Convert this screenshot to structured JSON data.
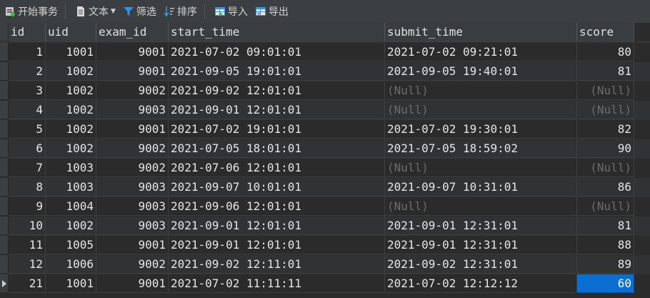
{
  "toolbar": {
    "begin_transaction": "开始事务",
    "text": "文本",
    "filter": "筛选",
    "sort": "排序",
    "import": "导入",
    "export": "导出"
  },
  "columns": [
    "id",
    "uid",
    "exam_id",
    "start_time",
    "submit_time",
    "score"
  ],
  "rows": [
    {
      "id": "1",
      "uid": "1001",
      "exam_id": "9001",
      "start_time": "2021-07-02 09:01:01",
      "submit_time": "2021-07-02 09:21:01",
      "score": "80"
    },
    {
      "id": "2",
      "uid": "1002",
      "exam_id": "9001",
      "start_time": "2021-09-05 19:01:01",
      "submit_time": "2021-09-05 19:40:01",
      "score": "81"
    },
    {
      "id": "3",
      "uid": "1002",
      "exam_id": "9002",
      "start_time": "2021-09-02 12:01:01",
      "submit_time": "(Null)",
      "score": "(Null)"
    },
    {
      "id": "4",
      "uid": "1002",
      "exam_id": "9003",
      "start_time": "2021-09-01 12:01:01",
      "submit_time": "(Null)",
      "score": "(Null)"
    },
    {
      "id": "5",
      "uid": "1002",
      "exam_id": "9001",
      "start_time": "2021-07-02 19:01:01",
      "submit_time": "2021-07-02 19:30:01",
      "score": "82"
    },
    {
      "id": "6",
      "uid": "1002",
      "exam_id": "9002",
      "start_time": "2021-07-05 18:01:01",
      "submit_time": "2021-07-05 18:59:02",
      "score": "90"
    },
    {
      "id": "7",
      "uid": "1003",
      "exam_id": "9002",
      "start_time": "2021-07-06 12:01:01",
      "submit_time": "(Null)",
      "score": "(Null)"
    },
    {
      "id": "8",
      "uid": "1003",
      "exam_id": "9003",
      "start_time": "2021-09-07 10:01:01",
      "submit_time": "2021-09-07 10:31:01",
      "score": "86"
    },
    {
      "id": "9",
      "uid": "1004",
      "exam_id": "9003",
      "start_time": "2021-09-06 12:01:01",
      "submit_time": "(Null)",
      "score": "(Null)"
    },
    {
      "id": "10",
      "uid": "1002",
      "exam_id": "9003",
      "start_time": "2021-09-01 12:01:01",
      "submit_time": "2021-09-01 12:31:01",
      "score": "81"
    },
    {
      "id": "11",
      "uid": "1005",
      "exam_id": "9001",
      "start_time": "2021-09-01 12:01:01",
      "submit_time": "2021-09-01 12:31:01",
      "score": "88"
    },
    {
      "id": "12",
      "uid": "1006",
      "exam_id": "9002",
      "start_time": "2021-09-02 12:11:01",
      "submit_time": "2021-09-02 12:31:01",
      "score": "89"
    },
    {
      "id": "21",
      "uid": "1001",
      "exam_id": "9001",
      "start_time": "2021-07-02 11:11:11",
      "submit_time": "2021-07-02 12:12:12",
      "score": "60"
    }
  ],
  "current_row_index": 12,
  "selected_column": "score",
  "null_text": "(Null)",
  "colors": {
    "selection": "#0a6fd1",
    "null_text": "#6c6c6c",
    "background": "#2b2b2b"
  }
}
